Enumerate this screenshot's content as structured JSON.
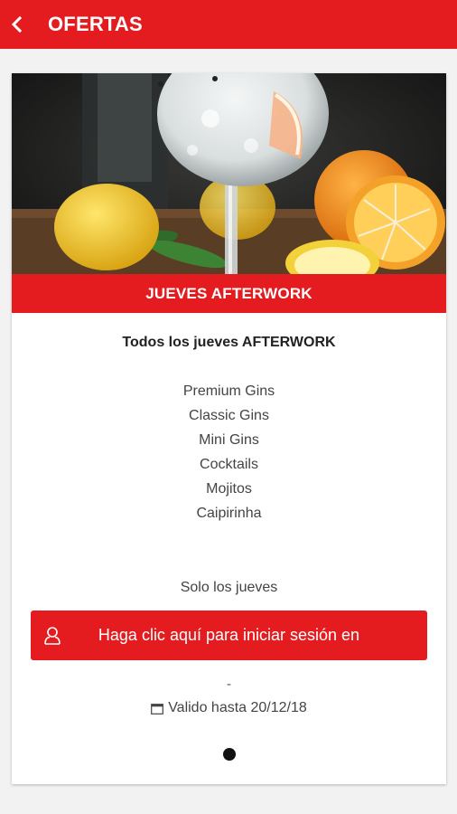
{
  "appbar": {
    "title": "OFERTAS",
    "back_icon": "chevron-left-icon",
    "color": "#e41c1f"
  },
  "offer": {
    "image": "gin-tonic-with-citrus-photo",
    "name": "JUEVES AFTERWORK",
    "heading": "Todos los jueves AFTERWORK",
    "items": [
      "Premium Gins",
      "Classic Gins",
      "Mini Gins",
      "Cocktails",
      "Mojitos",
      "Caipirinha"
    ],
    "note": "Solo los jueves",
    "login_button": "Haga clic aquí para iniciar sesión en",
    "login_icon": "user-icon",
    "dash": "-",
    "valid_icon": "calendar-icon",
    "valid_until": "Valido hasta 20/12/18"
  },
  "pager": {
    "current": 1,
    "total": 1
  }
}
